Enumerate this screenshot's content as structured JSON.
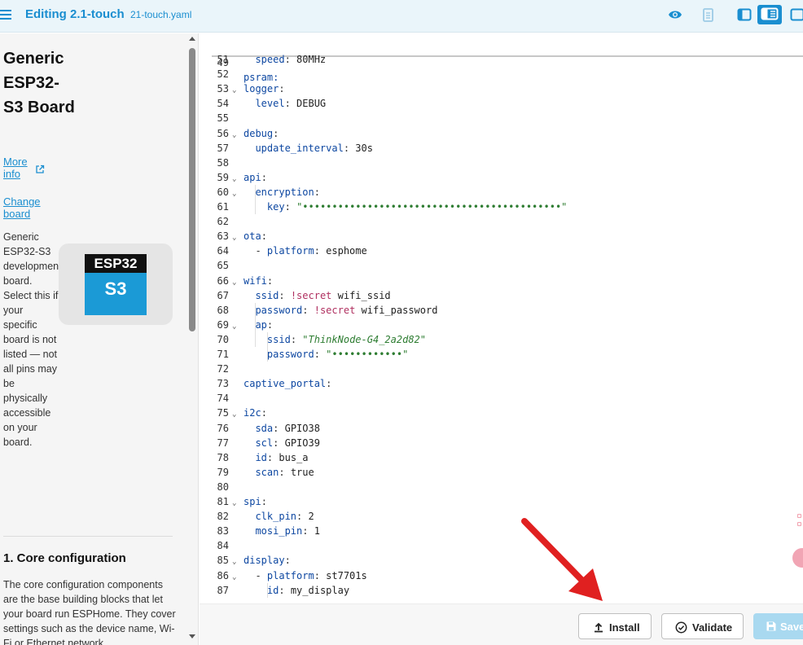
{
  "header": {
    "title": "Editing 2.1-touch",
    "filename": "21-touch.yaml",
    "icons": [
      "menu-icon",
      "eye-icon",
      "document-icon",
      "panel-left-icon",
      "panel-split-icon",
      "panel-right-icon"
    ]
  },
  "docs": {
    "board_title": "Generic ESP32-S3 Board",
    "more_info": "More info",
    "change_board": "Change board",
    "description": "Generic ESP32-S3 development board. Select this if your specific board is not listed — not all pins may be physically accessible on your board.",
    "chip_top": "ESP32",
    "chip_bottom": "S3",
    "section_title": "1. Core configuration",
    "section_body": "The core configuration components are the base building blocks that let your board run ESPHome. They cover settings such as the device name, Wi-Fi or Ethernet network"
  },
  "editor": {
    "sticky_line": {
      "num": "49",
      "text": "psram:"
    },
    "lines": [
      {
        "num": "51",
        "text": "  speed: 80MHz"
      },
      {
        "num": "52",
        "text": ""
      },
      {
        "num": "53",
        "text": "logger:",
        "fold": true
      },
      {
        "num": "54",
        "text": "  level: DEBUG"
      },
      {
        "num": "55",
        "text": ""
      },
      {
        "num": "56",
        "text": "debug:",
        "fold": true
      },
      {
        "num": "57",
        "text": "  update_interval: 30s"
      },
      {
        "num": "58",
        "text": ""
      },
      {
        "num": "59",
        "text": "api:",
        "fold": true
      },
      {
        "num": "60",
        "text": "  encryption:",
        "fold": true
      },
      {
        "num": "61",
        "text": "    key: \"••••••••••••••••••••••••••••••••••••••••••••\""
      },
      {
        "num": "62",
        "text": ""
      },
      {
        "num": "63",
        "text": "ota:",
        "fold": true
      },
      {
        "num": "64",
        "text": "  - platform: esphome"
      },
      {
        "num": "65",
        "text": ""
      },
      {
        "num": "66",
        "text": "wifi:",
        "fold": true
      },
      {
        "num": "67",
        "text": "  ssid: !secret wifi_ssid"
      },
      {
        "num": "68",
        "text": "  password: !secret wifi_password"
      },
      {
        "num": "69",
        "text": "  ap:",
        "fold": true
      },
      {
        "num": "70",
        "text": "    ssid: \"ThinkNode-G4_2a2d82\""
      },
      {
        "num": "71",
        "text": "    password: \"••••••••••••\""
      },
      {
        "num": "72",
        "text": ""
      },
      {
        "num": "73",
        "text": "captive_portal:"
      },
      {
        "num": "74",
        "text": ""
      },
      {
        "num": "75",
        "text": "i2c:",
        "fold": true
      },
      {
        "num": "76",
        "text": "  sda: GPIO38"
      },
      {
        "num": "77",
        "text": "  scl: GPIO39"
      },
      {
        "num": "78",
        "text": "  id: bus_a"
      },
      {
        "num": "79",
        "text": "  scan: true"
      },
      {
        "num": "80",
        "text": ""
      },
      {
        "num": "81",
        "text": "spi:",
        "fold": true
      },
      {
        "num": "82",
        "text": "  clk_pin: 2"
      },
      {
        "num": "83",
        "text": "  mosi_pin: 1"
      },
      {
        "num": "84",
        "text": ""
      },
      {
        "num": "85",
        "text": "display:",
        "fold": true
      },
      {
        "num": "86",
        "text": "  - platform: st7701s",
        "fold": true
      },
      {
        "num": "87",
        "text": "    id: my_display"
      }
    ]
  },
  "actions": {
    "install": "Install",
    "validate": "Validate",
    "save": "Save"
  },
  "colors": {
    "accent": "#1a8ed0",
    "header_bg": "#eaf5fa",
    "save_disabled": "#a9d9f0",
    "arrow": "#e02020"
  }
}
